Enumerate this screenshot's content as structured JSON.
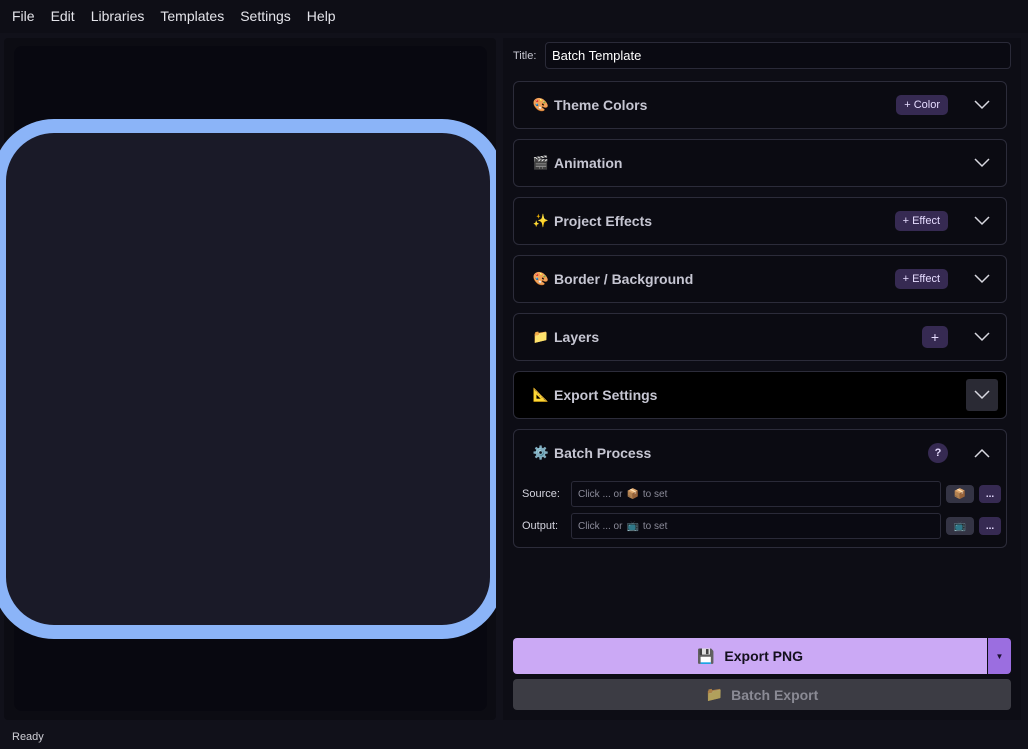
{
  "menu": [
    "File",
    "Edit",
    "Libraries",
    "Templates",
    "Settings",
    "Help"
  ],
  "title": {
    "label": "Title:",
    "value": "Batch Template"
  },
  "sections": {
    "theme": {
      "icon": "🎨",
      "title": "Theme Colors",
      "button": "+ Color"
    },
    "animation": {
      "icon": "🎬",
      "title": "Animation"
    },
    "effects": {
      "icon": "✨",
      "title": "Project Effects",
      "button": "+ Effect"
    },
    "border": {
      "icon": "🎨",
      "title": "Border / Background",
      "button": "+ Effect"
    },
    "layers": {
      "icon": "📁",
      "title": "Layers",
      "button": "+"
    },
    "export": {
      "icon": "📐",
      "title": "Export Settings"
    },
    "batch": {
      "icon": "⚙️",
      "title": "Batch Process",
      "button": "?"
    }
  },
  "batch": {
    "source": {
      "label": "Source:",
      "hint_prefix": "Click ... or",
      "hint_icon": "📦",
      "hint_suffix": "to set",
      "icon": "📦",
      "more": "..."
    },
    "output": {
      "label": "Output:",
      "hint_prefix": "Click ... or",
      "hint_icon": "📺",
      "hint_suffix": "to set",
      "icon": "📺",
      "more": "..."
    }
  },
  "export_png": {
    "icon": "💾",
    "label": "Export PNG",
    "dropdown": "▼"
  },
  "batch_export": {
    "icon": "📁",
    "label": "Batch Export"
  },
  "status": "Ready",
  "colors": {
    "accent": "#cba9f5",
    "frame": "#8bb4f8",
    "pill": "#362a52"
  }
}
